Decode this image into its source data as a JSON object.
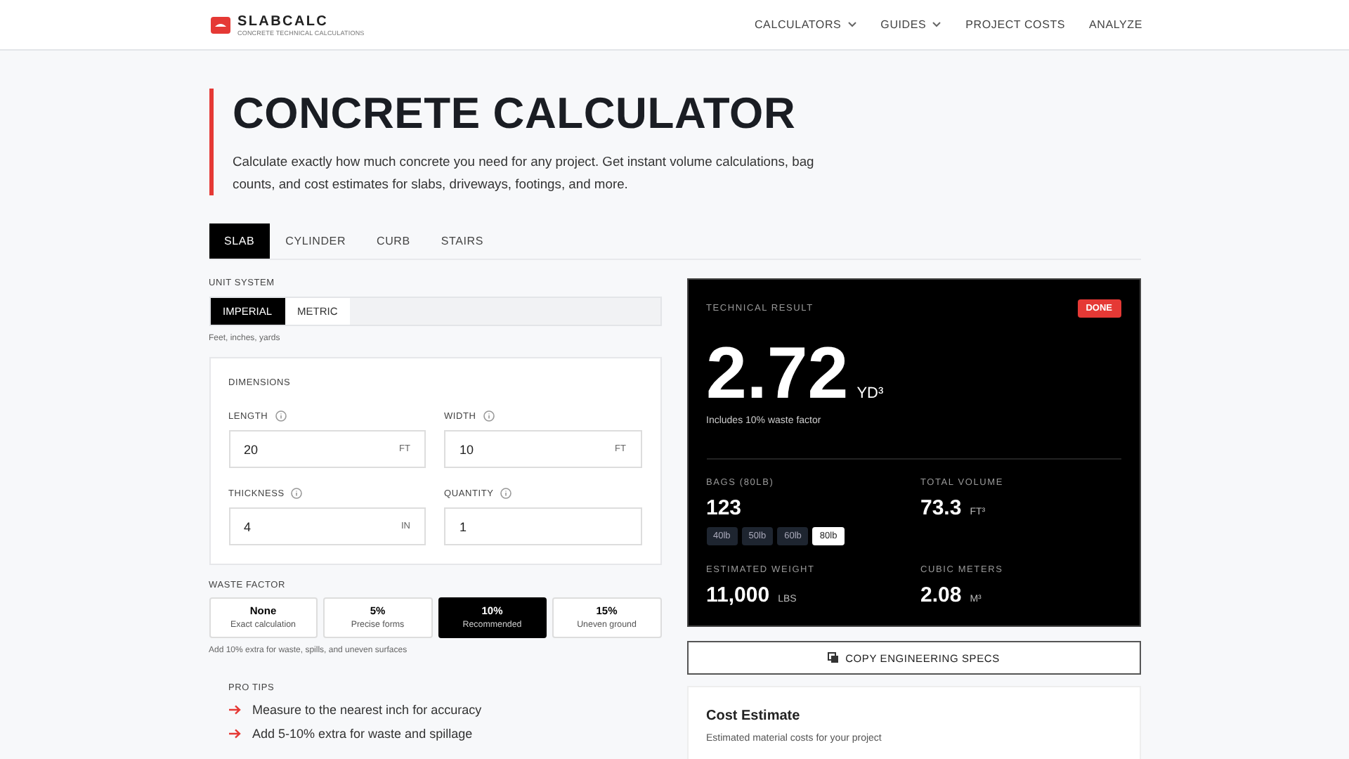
{
  "header": {
    "logo": "SLABCALC",
    "tagline": "CONCRETE TECHNICAL CALCULATIONS",
    "nav": [
      {
        "label": "CALCULATORS",
        "dropdown": true
      },
      {
        "label": "GUIDES",
        "dropdown": true
      },
      {
        "label": "PROJECT COSTS",
        "dropdown": false
      },
      {
        "label": "ANALYZE",
        "dropdown": false
      }
    ]
  },
  "hero": {
    "title": "CONCRETE CALCULATOR",
    "description": "Calculate exactly how much concrete you need for any project. Get instant volume calculations, bag counts, and cost estimates for slabs, driveways, footings, and more."
  },
  "tabs": [
    {
      "label": "SLAB",
      "selected": true
    },
    {
      "label": "CYLINDER",
      "selected": false
    },
    {
      "label": "CURB",
      "selected": false
    },
    {
      "label": "STAIRS",
      "selected": false
    }
  ],
  "unit_system": {
    "label": "UNIT SYSTEM",
    "options": [
      {
        "label": "IMPERIAL",
        "selected": true
      },
      {
        "label": "METRIC",
        "selected": false
      }
    ],
    "hint": "Feet, inches, yards"
  },
  "dimensions": {
    "title": "DIMENSIONS",
    "fields": [
      {
        "label": "LENGTH",
        "value": "20",
        "unit": "FT"
      },
      {
        "label": "WIDTH",
        "value": "10",
        "unit": "FT"
      },
      {
        "label": "THICKNESS",
        "value": "4",
        "unit": "IN"
      },
      {
        "label": "QUANTITY",
        "value": "1"
      }
    ]
  },
  "waste_factor": {
    "label": "WASTE FACTOR",
    "options": [
      {
        "value": "None",
        "caption": "Exact calculation",
        "selected": false
      },
      {
        "value": "5%",
        "caption": "Precise forms",
        "selected": false
      },
      {
        "value": "10%",
        "caption": "Recommended",
        "selected": true
      },
      {
        "value": "15%",
        "caption": "Uneven ground",
        "selected": false
      }
    ],
    "hint": "Add 10% extra for waste, spills, and uneven surfaces"
  },
  "pro_tips": {
    "title": "PRO TIPS",
    "items": [
      "Measure to the nearest inch for accuracy",
      "Add 5-10% extra for waste and spillage"
    ]
  },
  "result": {
    "label": "TECHNICAL RESULT",
    "badge": "DONE",
    "value": "2.72",
    "unit": "YD³",
    "note": "Includes 10% waste factor",
    "stats": [
      {
        "label": "BAGS (80LB)",
        "value": "123",
        "bag_sizes": [
          {
            "label": "40lb",
            "selected": false
          },
          {
            "label": "50lb",
            "selected": false
          },
          {
            "label": "60lb",
            "selected": false
          },
          {
            "label": "80lb",
            "selected": true
          }
        ]
      },
      {
        "label": "TOTAL VOLUME",
        "value": "73.3",
        "unit": "FT³"
      },
      {
        "label": "ESTIMATED WEIGHT",
        "value": "11,000",
        "unit": "LBS"
      },
      {
        "label": "CUBIC METERS",
        "value": "2.08",
        "unit": "M³"
      }
    ]
  },
  "copy_button": "COPY ENGINEERING SPECS",
  "cost_estimate": {
    "title": "Cost Estimate",
    "subtitle": "Estimated material costs for your project"
  }
}
